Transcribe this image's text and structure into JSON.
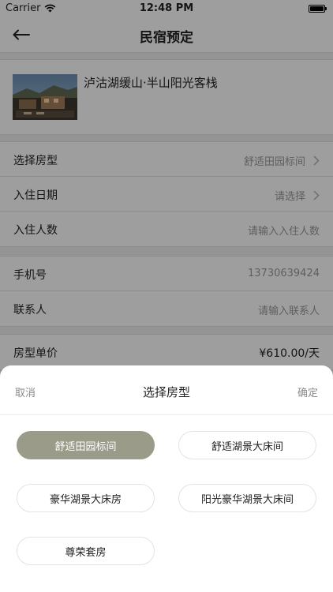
{
  "status_bar": {
    "carrier": "Carrier",
    "time": "12:48 PM"
  },
  "nav": {
    "title": "民宿预定"
  },
  "hotel": {
    "name": "泸沽湖缓山·半山阳光客栈"
  },
  "form": {
    "room_type_label": "选择房型",
    "room_type_value": "舒适田园标间",
    "checkin_label": "入住日期",
    "checkin_value": "请选择",
    "guests_label": "入住人数",
    "guests_placeholder": "请输入入住人数",
    "phone_label": "手机号",
    "phone_value": "13730639424",
    "contact_label": "联系人",
    "contact_placeholder": "请输入联系人",
    "price_label": "房型单价",
    "price_value": "¥610.00/天"
  },
  "sheet": {
    "cancel": "取消",
    "title": "选择房型",
    "confirm": "确定",
    "options": [
      {
        "label": "舒适田园标间",
        "selected": true
      },
      {
        "label": "舒适湖景大床间",
        "selected": false
      },
      {
        "label": "豪华湖景大床房",
        "selected": false
      },
      {
        "label": "阳光豪华湖景大床间",
        "selected": false
      },
      {
        "label": "尊荣套房",
        "selected": false
      }
    ]
  },
  "colors": {
    "selected_option": "#9a9b89",
    "overlay": "rgba(0,0,0,0.38)",
    "placeholder": "#999999"
  }
}
